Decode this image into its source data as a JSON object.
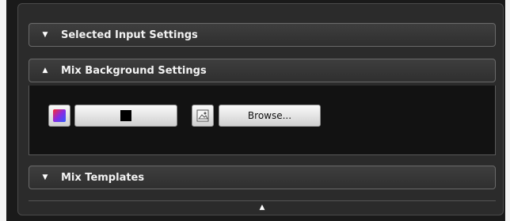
{
  "sections": {
    "selected_input": {
      "label": "Selected Input Settings",
      "expanded": false
    },
    "mix_background": {
      "label": "Mix Background Settings",
      "expanded": true
    },
    "mix_templates": {
      "label": "Mix Templates",
      "expanded": false
    }
  },
  "mix_background": {
    "color_value": "#000000",
    "browse_label": "Browse..."
  },
  "icons": {
    "collapsed": "triangle-down-icon",
    "expanded": "triangle-up-icon",
    "color_picker": "color-gradient-icon",
    "image": "image-icon",
    "scroll_up": "triangle-up-icon"
  },
  "colors": {
    "panel_bg": "#2b2b2b",
    "header_bg": "#3a3a3a",
    "body_bg": "#121212",
    "text": "#f2f2f2"
  }
}
